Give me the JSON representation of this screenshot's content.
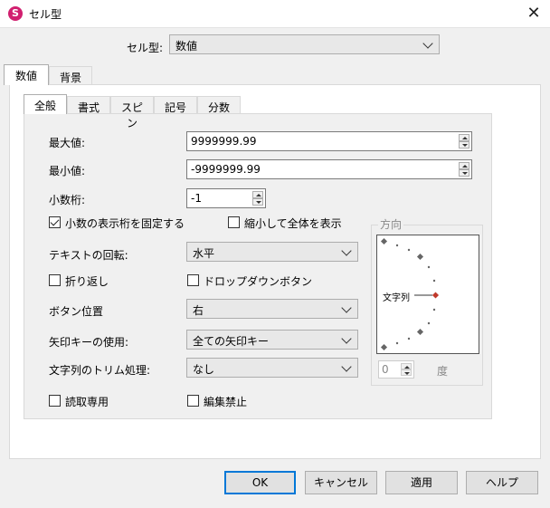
{
  "window": {
    "title": "セル型",
    "app_icon_glyph": "S",
    "close_glyph": "✕"
  },
  "celltype": {
    "label": "セル型:",
    "value": "数値"
  },
  "outer_tabs": [
    {
      "label": "数値",
      "active": true
    },
    {
      "label": "背景",
      "active": false
    }
  ],
  "inner_tabs": [
    {
      "label": "全般",
      "active": true
    },
    {
      "label": "書式",
      "active": false
    },
    {
      "label": "スピン",
      "active": false
    },
    {
      "label": "記号",
      "active": false
    },
    {
      "label": "分数",
      "active": false
    }
  ],
  "general": {
    "max_label": "最大値:",
    "max_value": "9999999.99",
    "min_label": "最小値:",
    "min_value": "-9999999.99",
    "decimals_label": "小数桁:",
    "decimals_value": "-1",
    "fix_decimal_label": "小数の表示桁を固定する",
    "fix_decimal_checked": true,
    "shrink_label": "縮小して全体を表示",
    "shrink_checked": false,
    "rotation_label": "テキストの回転:",
    "rotation_value": "水平",
    "wrap_label": "折り返し",
    "wrap_checked": false,
    "dropdown_button_label": "ドロップダウンボタン",
    "dropdown_button_checked": false,
    "button_position_label": "ボタン位置",
    "button_position_value": "右",
    "arrow_keys_label": "矢印キーの使用:",
    "arrow_keys_value": "全ての矢印キー",
    "trim_label": "文字列のトリム処理:",
    "trim_value": "なし",
    "readonly_label": "読取専用",
    "readonly_checked": false,
    "edit_disabled_label": "編集禁止",
    "edit_disabled_checked": false
  },
  "orientation": {
    "group_title": "方向",
    "dial_text": "文字列",
    "degree_value": "0",
    "degree_unit": "度"
  },
  "buttons": {
    "ok": "OK",
    "cancel": "キャンセル",
    "apply": "適用",
    "help": "ヘルプ"
  },
  "colors": {
    "accent": "#0078d7",
    "dial_marker": "#c0392b",
    "app_icon": "#d11f6f"
  }
}
